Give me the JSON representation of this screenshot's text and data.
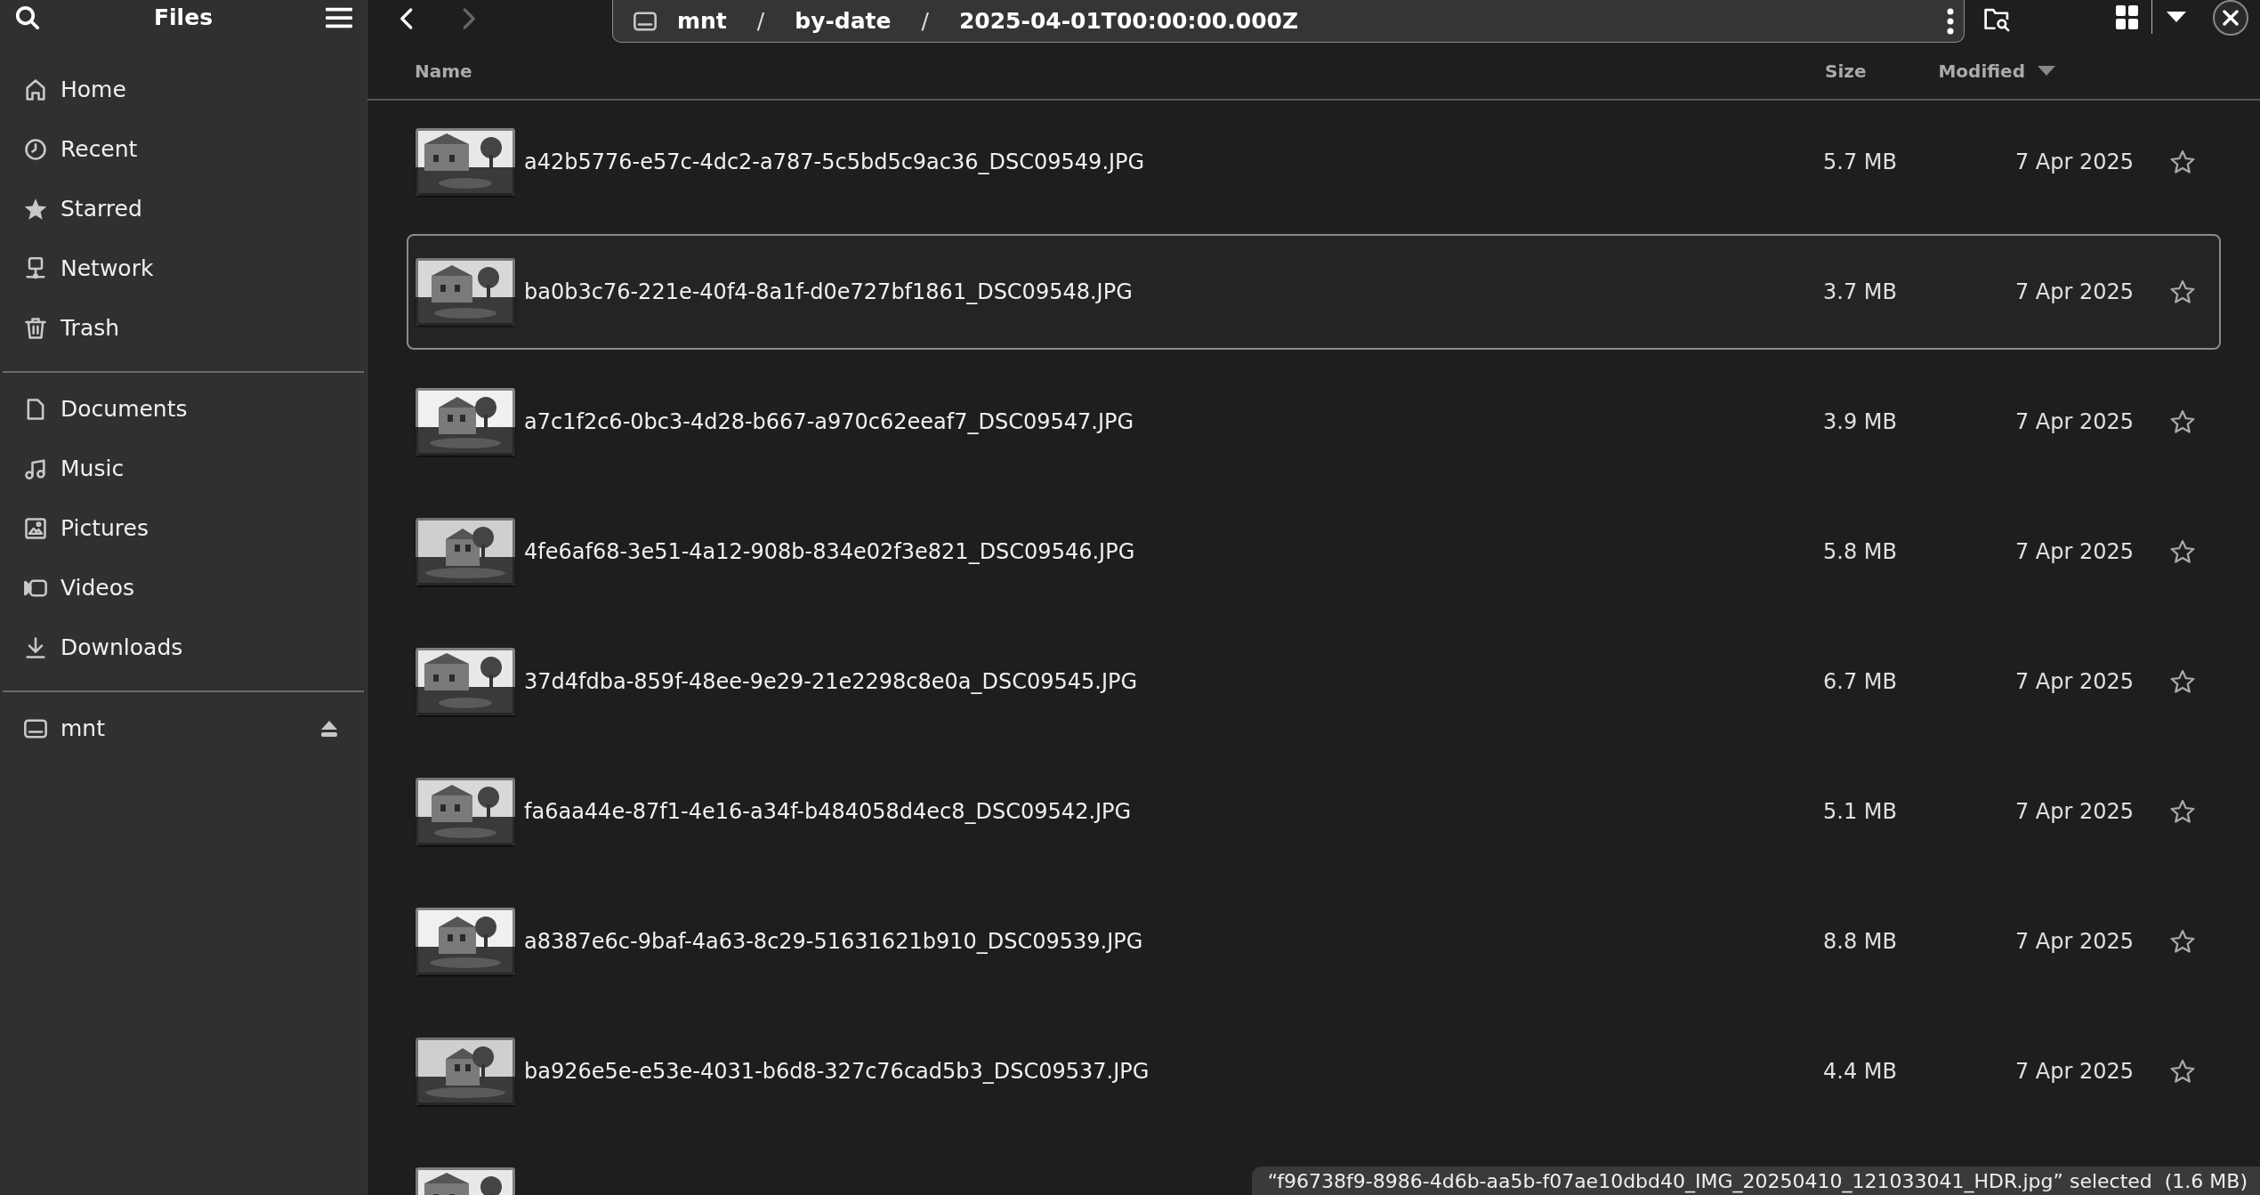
{
  "sidebar": {
    "title": "Files",
    "sections": [
      {
        "items": [
          {
            "label": "Home"
          },
          {
            "label": "Recent"
          },
          {
            "label": "Starred"
          },
          {
            "label": "Network"
          },
          {
            "label": "Trash"
          }
        ]
      },
      {
        "items": [
          {
            "label": "Documents"
          },
          {
            "label": "Music"
          },
          {
            "label": "Pictures"
          },
          {
            "label": "Videos"
          },
          {
            "label": "Downloads"
          }
        ]
      },
      {
        "items": [
          {
            "label": "mnt",
            "ejectable": true
          }
        ]
      }
    ]
  },
  "path_bar": {
    "segments": [
      "mnt",
      "by-date",
      "2025-04-01T00:00:00.000Z"
    ],
    "separator": "/"
  },
  "columns": [
    "Name",
    "Size",
    "Modified"
  ],
  "files": [
    {
      "name": "a42b5776-e57c-4dc2-a787-5c5bd5c9ac36_DSC09549.JPG",
      "size": "5.7 MB",
      "modified": "7 Apr 2025",
      "starred": false,
      "focused": false
    },
    {
      "name": "ba0b3c76-221e-40f4-8a1f-d0e727bf1861_DSC09548.JPG",
      "size": "3.7 MB",
      "modified": "7 Apr 2025",
      "starred": false,
      "focused": true
    },
    {
      "name": "a7c1f2c6-0bc3-4d28-b667-a970c62eeaf7_DSC09547.JPG",
      "size": "3.9 MB",
      "modified": "7 Apr 2025",
      "starred": false,
      "focused": false
    },
    {
      "name": "4fe6af68-3e51-4a12-908b-834e02f3e821_DSC09546.JPG",
      "size": "5.8 MB",
      "modified": "7 Apr 2025",
      "starred": false,
      "focused": false
    },
    {
      "name": "37d4fdba-859f-48ee-9e29-21e2298c8e0a_DSC09545.JPG",
      "size": "6.7 MB",
      "modified": "7 Apr 2025",
      "starred": false,
      "focused": false
    },
    {
      "name": "fa6aa44e-87f1-4e16-a34f-b484058d4ec8_DSC09542.JPG",
      "size": "5.1 MB",
      "modified": "7 Apr 2025",
      "starred": false,
      "focused": false
    },
    {
      "name": "a8387e6c-9baf-4a63-8c29-51631621b910_DSC09539.JPG",
      "size": "8.8 MB",
      "modified": "7 Apr 2025",
      "starred": false,
      "focused": false
    },
    {
      "name": "ba926e5e-e53e-4031-b6d8-327c76cad5b3_DSC09537.JPG",
      "size": "4.4 MB",
      "modified": "7 Apr 2025",
      "starred": false,
      "focused": false
    },
    {
      "kind": "picture"
    }
  ],
  "status": "“f96738f9-8986-4d6b-aa5b-f07ae10dbd40_IMG_20250410_121033041_HDR.jpg” selected  (1.6 MB)"
}
